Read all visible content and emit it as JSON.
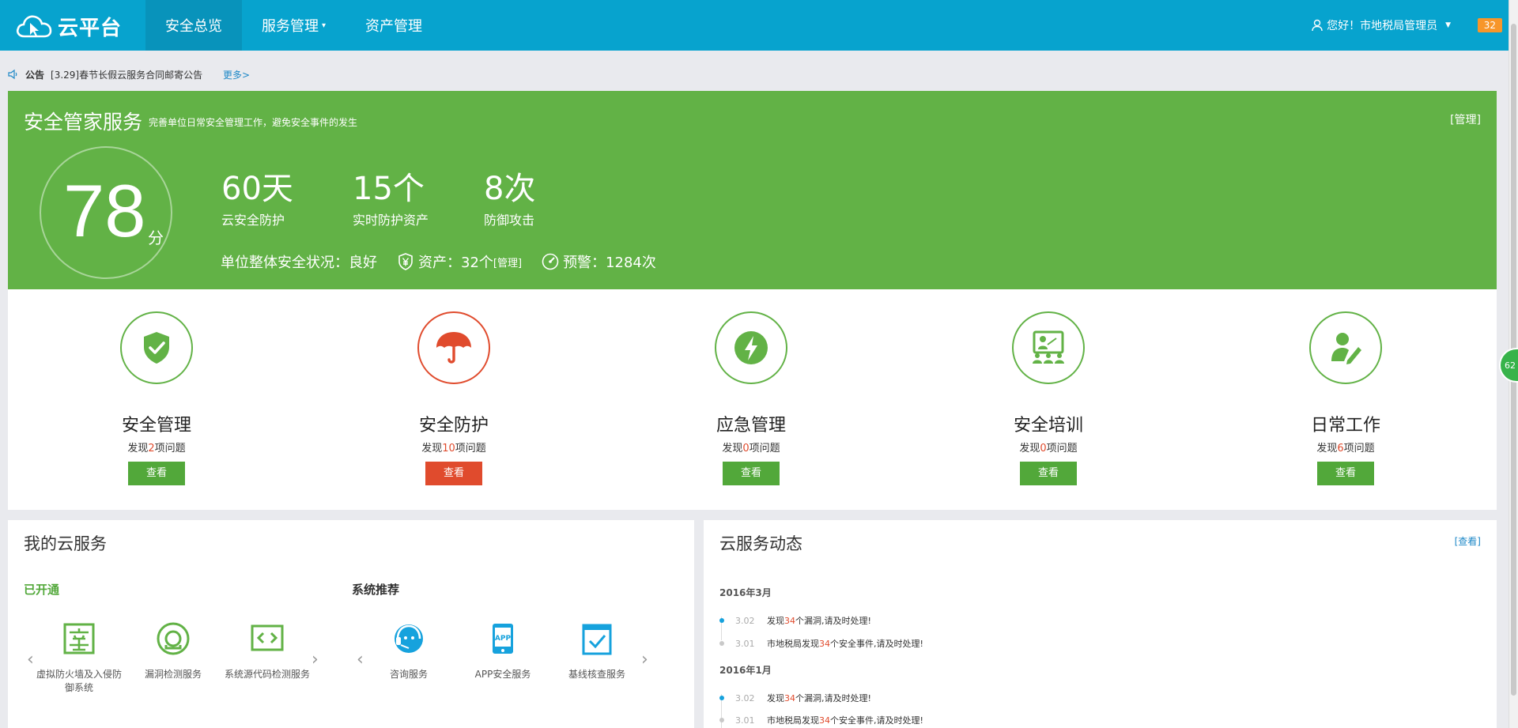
{
  "nav": {
    "logo": "云平台",
    "items": [
      {
        "label": "安全总览",
        "caret": ""
      },
      {
        "label": "服务管理",
        "caret": "▾"
      },
      {
        "label": "资产管理",
        "caret": ""
      }
    ],
    "user": "您好！市地税局管理员",
    "badge": "32",
    "float_ball": "62"
  },
  "notice": {
    "label": "公告",
    "text": "[3.29]春节长假云服务合同邮寄公告",
    "more": "更多>"
  },
  "banner": {
    "title": "安全管家服务",
    "subtitle": "完善单位日常安全管理工作，避免安全事件的发生",
    "manage": "[管理]",
    "score": "78",
    "score_unit": "分",
    "stats": [
      {
        "value": "60天",
        "label": "云安全防护"
      },
      {
        "value": "15个",
        "label": "实时防护资产"
      },
      {
        "value": "8次",
        "label": "防御攻击"
      }
    ],
    "status": "单位整体安全状况：良好",
    "assets": "资产：32个",
    "assets_link": "[管理]",
    "alerts": "预警：1284次"
  },
  "categories": [
    {
      "title": "安全管理",
      "desc_prefix": "发现",
      "count": "2",
      "desc_suffix": "项问题",
      "button": "查看",
      "color": "#62b246"
    },
    {
      "title": "安全防护",
      "desc_prefix": "发现",
      "count": "10",
      "desc_suffix": "项问题",
      "button": "查看",
      "color": "#e04b2d"
    },
    {
      "title": "应急管理",
      "desc_prefix": "发现",
      "count": "0",
      "desc_suffix": "项问题",
      "button": "查看",
      "color": "#62b246"
    },
    {
      "title": "安全培训",
      "desc_prefix": "发现",
      "count": "0",
      "desc_suffix": "项问题",
      "button": "查看",
      "color": "#62b246"
    },
    {
      "title": "日常工作",
      "desc_prefix": "发现",
      "count": "6",
      "desc_suffix": "项问题",
      "button": "查看",
      "color": "#62b246"
    }
  ],
  "my_services": {
    "title": "我的云服务",
    "opened_label": "已开通",
    "recommend_label": "系统推荐",
    "opened": [
      {
        "label": "虚拟防火墙及入侵防御系统",
        "icon": "firewall-icon"
      },
      {
        "label": "漏洞检测服务",
        "icon": "vulnerability-scan-icon"
      },
      {
        "label": "系统源代码检测服务",
        "icon": "source-code-icon"
      }
    ],
    "recommended": [
      {
        "label": "咨询服务",
        "icon": "consult-icon"
      },
      {
        "label": "APP安全服务",
        "icon": "app-security-icon"
      },
      {
        "label": "基线核查服务",
        "icon": "baseline-check-icon"
      }
    ],
    "prev": "‹",
    "next": "›"
  },
  "cloud_news": {
    "title": "云服务动态",
    "link": "[查看]",
    "groups": [
      {
        "date": "2016年3月",
        "events": [
          {
            "day": "3.02",
            "prefix": "发现",
            "count": "34",
            "suffix": "个漏洞,请及时处理!"
          },
          {
            "day": "3.01",
            "prefix": "市地税局发现",
            "count": "34",
            "suffix": "个安全事件,请及时处理!"
          }
        ]
      },
      {
        "date": "2016年1月",
        "events": [
          {
            "day": "3.02",
            "prefix": "发现",
            "count": "34",
            "suffix": "个漏洞,请及时处理!"
          },
          {
            "day": "3.01",
            "prefix": "市地税局发现",
            "count": "34",
            "suffix": "个安全事件,请及时处理!"
          }
        ]
      }
    ]
  }
}
